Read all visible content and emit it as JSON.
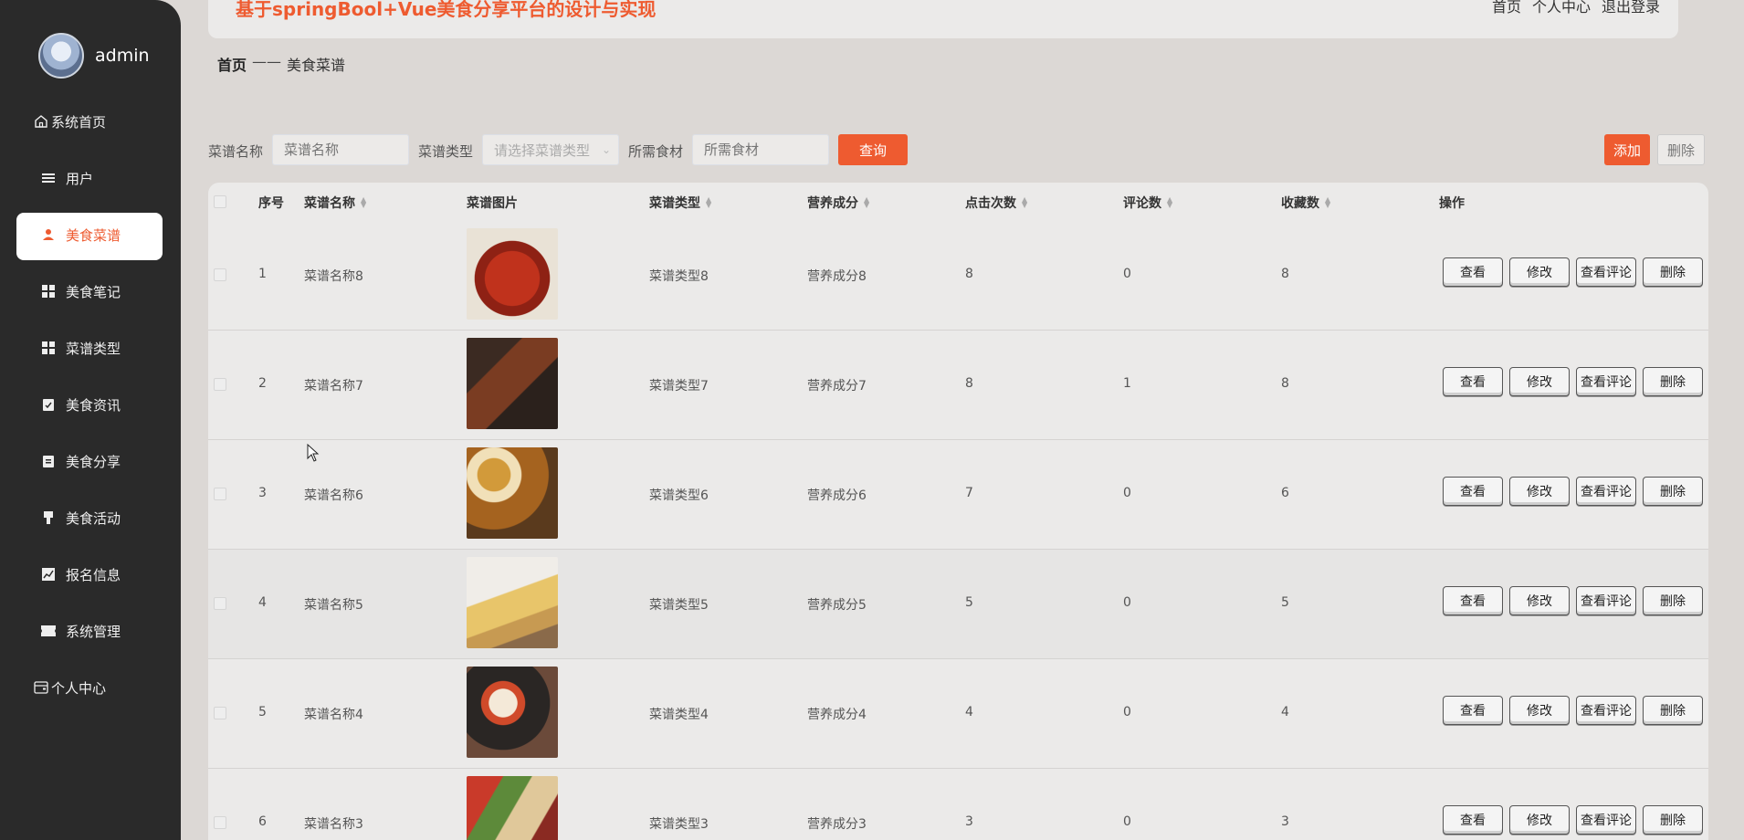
{
  "header": {
    "title": "基于springBool+Vue美食分享平台的设计与实现",
    "links": [
      "首页",
      "个人中心",
      "退出登录"
    ]
  },
  "user": {
    "name": "admin"
  },
  "sidebar": {
    "items": [
      {
        "label": "系统首页",
        "icon": "home-icon"
      },
      {
        "label": "用户",
        "icon": "list-icon"
      },
      {
        "label": "美食菜谱",
        "icon": "user-icon",
        "active": true
      },
      {
        "label": "美食笔记",
        "icon": "grid-icon"
      },
      {
        "label": "菜谱类型",
        "icon": "grid-icon"
      },
      {
        "label": "美食资讯",
        "icon": "clipboard-check-icon"
      },
      {
        "label": "美食分享",
        "icon": "clipboard-icon"
      },
      {
        "label": "美食活动",
        "icon": "pin-icon"
      },
      {
        "label": "报名信息",
        "icon": "chart-icon"
      },
      {
        "label": "系统管理",
        "icon": "ticket-icon"
      },
      {
        "label": "个人中心",
        "icon": "wallet-icon"
      }
    ]
  },
  "breadcrumb": {
    "home": "首页",
    "sep": "——",
    "current": "美食菜谱"
  },
  "search": {
    "name_label": "菜谱名称",
    "name_placeholder": "菜谱名称",
    "type_label": "菜谱类型",
    "type_placeholder": "请选择菜谱类型",
    "ingredient_label": "所需食材",
    "ingredient_placeholder": "所需食材",
    "query_button": "查询",
    "add_button": "添加",
    "delete_button": "删除"
  },
  "table": {
    "headers": [
      "序号",
      "菜谱名称",
      "菜谱图片",
      "菜谱类型",
      "营养成分",
      "点击次数",
      "评论数",
      "收藏数",
      "操作"
    ],
    "actions": [
      "查看",
      "修改",
      "查看评论",
      "删除"
    ],
    "rows": [
      {
        "no": "1",
        "name": "菜谱名称8",
        "type": "菜谱类型8",
        "nutrition": "营养成分8",
        "clicks": "8",
        "comments": "0",
        "favorites": "8"
      },
      {
        "no": "2",
        "name": "菜谱名称7",
        "type": "菜谱类型7",
        "nutrition": "营养成分7",
        "clicks": "8",
        "comments": "1",
        "favorites": "8"
      },
      {
        "no": "3",
        "name": "菜谱名称6",
        "type": "菜谱类型6",
        "nutrition": "营养成分6",
        "clicks": "7",
        "comments": "0",
        "favorites": "6"
      },
      {
        "no": "4",
        "name": "菜谱名称5",
        "type": "菜谱类型5",
        "nutrition": "营养成分5",
        "clicks": "5",
        "comments": "0",
        "favorites": "5"
      },
      {
        "no": "5",
        "name": "菜谱名称4",
        "type": "菜谱类型4",
        "nutrition": "营养成分4",
        "clicks": "4",
        "comments": "0",
        "favorites": "4"
      },
      {
        "no": "6",
        "name": "菜谱名称3",
        "type": "菜谱类型3",
        "nutrition": "营养成分3",
        "clicks": "3",
        "comments": "0",
        "favorites": "3"
      }
    ]
  },
  "colors": {
    "accent": "#ee5b30",
    "sidebar_bg": "#2a2a2a",
    "page_bg": "#dcd8d5"
  }
}
